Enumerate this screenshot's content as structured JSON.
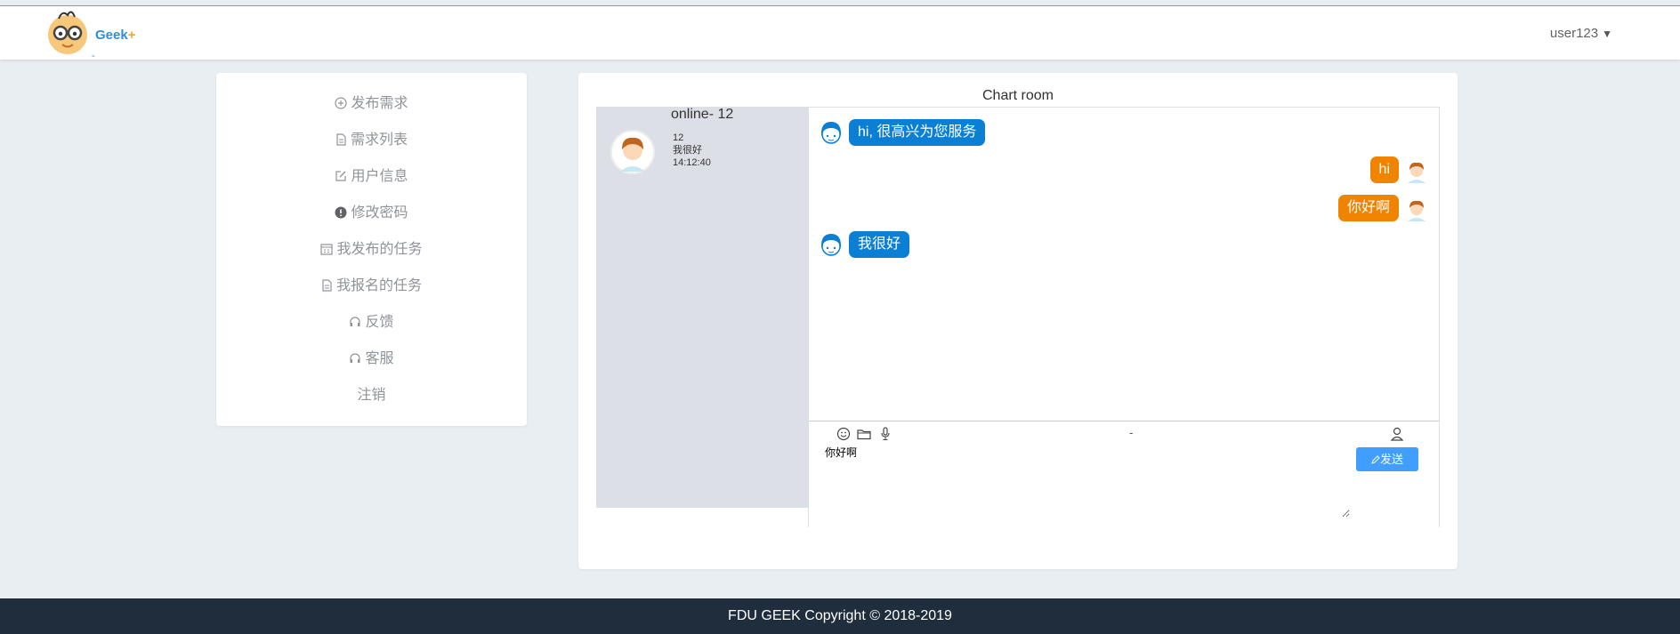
{
  "header": {
    "logo_text": "Geek",
    "logo_plus": "+",
    "logo_dash": "-",
    "user": "user123",
    "caret": "▼"
  },
  "sidebar": {
    "items": [
      {
        "label": "发布需求",
        "icon": "plus-circle-icon"
      },
      {
        "label": "需求列表",
        "icon": "document-icon"
      },
      {
        "label": "用户信息",
        "icon": "edit-icon"
      },
      {
        "label": "修改密码",
        "icon": "warning-icon"
      },
      {
        "label": "我发布的任务",
        "icon": "calendar-icon"
      },
      {
        "label": "我报名的任务",
        "icon": "document-icon"
      },
      {
        "label": "反馈",
        "icon": "headset-icon"
      },
      {
        "label": "客服",
        "icon": "headset-icon"
      },
      {
        "label": "注销",
        "icon": ""
      }
    ]
  },
  "chat": {
    "title": "Chart room",
    "online": "online- 12",
    "contact": {
      "name": "12",
      "last_message": "我很好",
      "time": "14:12:40"
    },
    "messages": [
      {
        "side": "in",
        "text": "hi, 很高兴为您服务"
      },
      {
        "side": "out",
        "text": "hi"
      },
      {
        "side": "out",
        "text": "你好啊"
      },
      {
        "side": "in",
        "text": "我很好"
      }
    ],
    "compose": {
      "dash": "-",
      "input_value": "你好啊",
      "send_label": "发送",
      "tools": [
        "emoji-icon",
        "folder-icon",
        "microphone-icon"
      ]
    }
  },
  "footer": {
    "text": "FDU GEEK Copyright © 2018-2019"
  },
  "colors": {
    "incoming_bubble": "#0b7fd3",
    "outgoing_bubble": "#f08300",
    "send_button": "#409eff",
    "footer_bg": "#1f2d3d",
    "page_bg": "#e9eef3"
  }
}
